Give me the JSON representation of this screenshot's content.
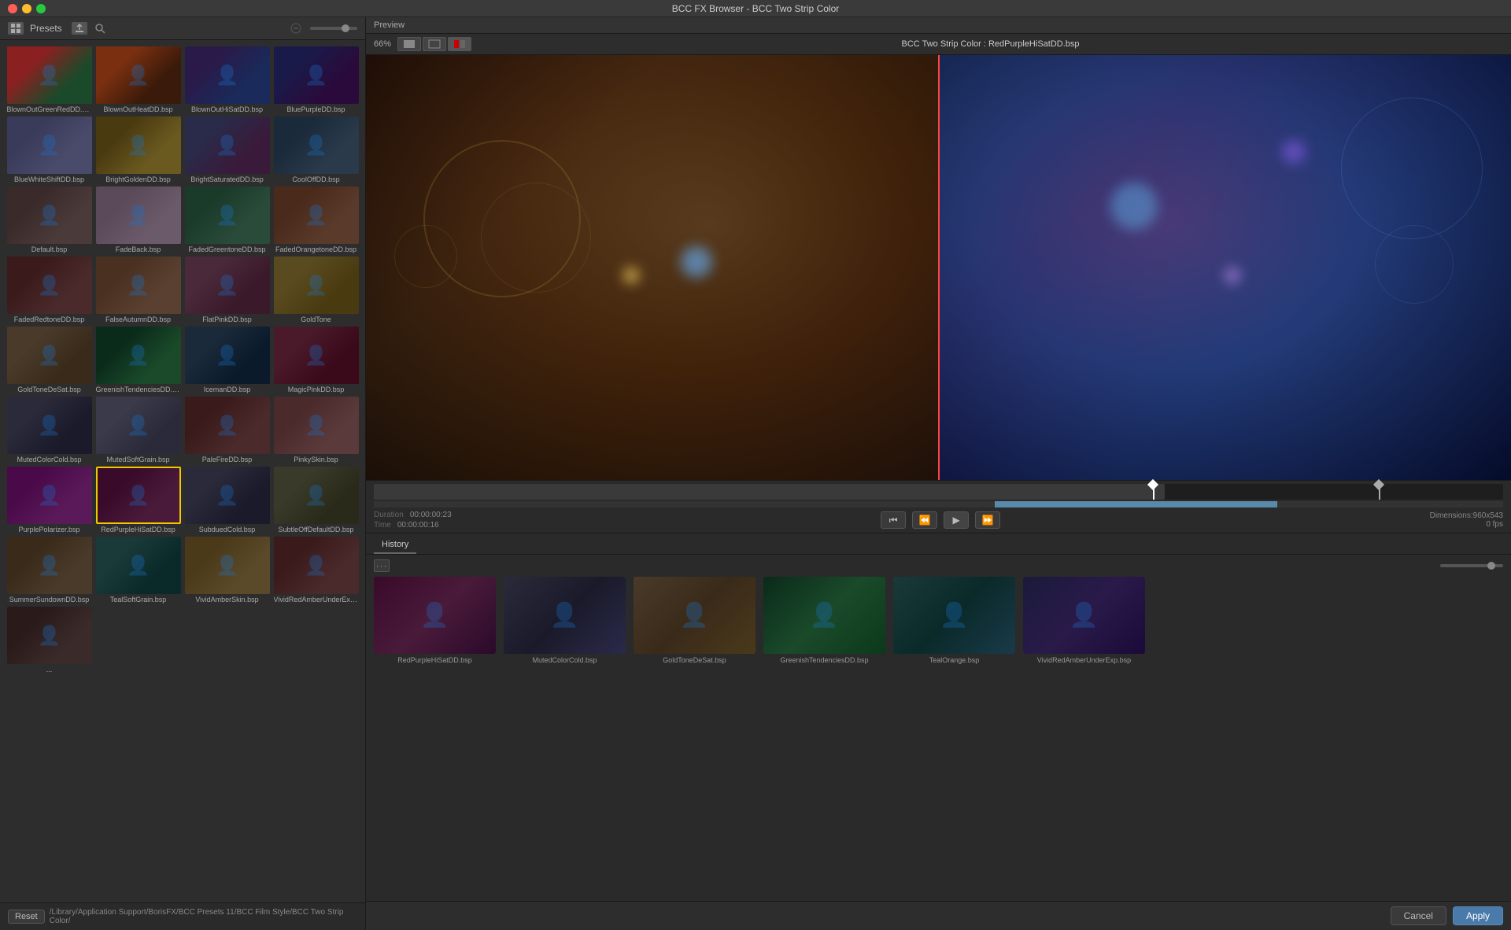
{
  "window": {
    "title": "BCC FX Browser - BCC Two Strip Color"
  },
  "titlebar": {
    "close_label": "",
    "min_label": "",
    "max_label": "",
    "title": "BCC FX Browser - BCC Two Strip Color"
  },
  "left_panel": {
    "header": {
      "presets_label": "Presets"
    },
    "presets": [
      {
        "name": "BlownOutGreenRedDD.bsp",
        "thumb_class": "thumb-blown-green"
      },
      {
        "name": "BlownOutHeatDD.bsp",
        "thumb_class": "thumb-blown-heat"
      },
      {
        "name": "BlownOutHiSatDD.bsp",
        "thumb_class": "thumb-blown-sat"
      },
      {
        "name": "BluePurpleDD.bsp",
        "thumb_class": "thumb-blue-purple"
      },
      {
        "name": "BlueWhiteShiftDD.bsp",
        "thumb_class": "thumb-blue-white"
      },
      {
        "name": "BrightGoldenDD.bsp",
        "thumb_class": "thumb-bright-golden"
      },
      {
        "name": "BrightSaturatedDD.bsp",
        "thumb_class": "thumb-bright-sat"
      },
      {
        "name": "CoolOffDD.bsp",
        "thumb_class": "thumb-cool-off"
      },
      {
        "name": "Default.bsp",
        "thumb_class": "thumb-default"
      },
      {
        "name": "FadeBack.bsp",
        "thumb_class": "thumb-fadeback"
      },
      {
        "name": "FadedGreentoneDD.bsp",
        "thumb_class": "thumb-faded-green"
      },
      {
        "name": "FadedOrangetoneDD.bsp",
        "thumb_class": "thumb-faded-orange"
      },
      {
        "name": "FadedRedtoneDD.bsp",
        "thumb_class": "thumb-faded-red"
      },
      {
        "name": "FalseAutumnDD.bsp",
        "thumb_class": "thumb-false-autumn"
      },
      {
        "name": "FlatPinkDD.bsp",
        "thumb_class": "thumb-flat-pink"
      },
      {
        "name": "GoldTone",
        "thumb_class": "thumb-gold-tone"
      },
      {
        "name": "GoldToneDeSat.bsp",
        "thumb_class": "thumb-gold-desat"
      },
      {
        "name": "GreenishTendenciesDD.bsp",
        "thumb_class": "thumb-greenish"
      },
      {
        "name": "IcemanDD.bsp",
        "thumb_class": "thumb-iceman"
      },
      {
        "name": "MagicPinkDD.bsp",
        "thumb_class": "thumb-magic-pink"
      },
      {
        "name": "MutedColorCold.bsp",
        "thumb_class": "thumb-muted-cold"
      },
      {
        "name": "MutedSoftGrain.bsp",
        "thumb_class": "thumb-muted-soft"
      },
      {
        "name": "PaleFireDD.bsp",
        "thumb_class": "thumb-pale-fire"
      },
      {
        "name": "PinkySkin.bsp",
        "thumb_class": "thumb-pinky-skin"
      },
      {
        "name": "PurplePolarizer.bsp",
        "thumb_class": "thumb-purple-pol"
      },
      {
        "name": "RedPurpleHiSatDD.bsp",
        "thumb_class": "thumb-red-purple",
        "selected": true
      },
      {
        "name": "SubduedCold.bsp",
        "thumb_class": "thumb-subdued"
      },
      {
        "name": "SubtleOffDefaultDD.bsp",
        "thumb_class": "thumb-subtle-off"
      },
      {
        "name": "SummerSundownDD.bsp",
        "thumb_class": "thumb-summer"
      },
      {
        "name": "TealSoftGrain.bsp",
        "thumb_class": "thumb-teal"
      },
      {
        "name": "VividAmberSkin.bsp",
        "thumb_class": "thumb-vivid-amber"
      },
      {
        "name": "VividRedAmberUnderExp.bsp",
        "thumb_class": "thumb-vivid-red"
      },
      {
        "name": "...",
        "thumb_class": "thumb-more"
      }
    ],
    "path": "/Library/Application Support/BorisFX/BCC Presets 11/BCC Film Style/BCC Two Strip Color/",
    "reset_label": "Reset"
  },
  "preview_panel": {
    "header_label": "Preview",
    "zoom_label": "66%",
    "preset_title": "BCC Two Strip Color : RedPurpleHiSatDD.bsp",
    "duration_label": "Duration",
    "time_label": "Time",
    "duration_value": "00:00:00:23",
    "time_value": "00:00:00:16",
    "dimensions_label": "Dimensions:960x543",
    "fps_label": "0 fps"
  },
  "history_panel": {
    "tab_label": "History",
    "items": [
      {
        "name": "RedPurpleHiSatDD.bsp",
        "thumb_class": "h-thumb-1"
      },
      {
        "name": "MutedColorCold.bsp",
        "thumb_class": "h-thumb-2"
      },
      {
        "name": "GoldToneDeSat.bsp",
        "thumb_class": "h-thumb-3"
      },
      {
        "name": "GreenishTendenciesDD.bsp",
        "thumb_class": "h-thumb-4"
      },
      {
        "name": "TealOrange.bsp",
        "thumb_class": "h-thumb-5"
      },
      {
        "name": "VividRedAmberUnderExp.bsp",
        "thumb_class": "h-thumb-6"
      }
    ]
  },
  "action_bar": {
    "cancel_label": "Cancel",
    "apply_label": "Apply"
  }
}
